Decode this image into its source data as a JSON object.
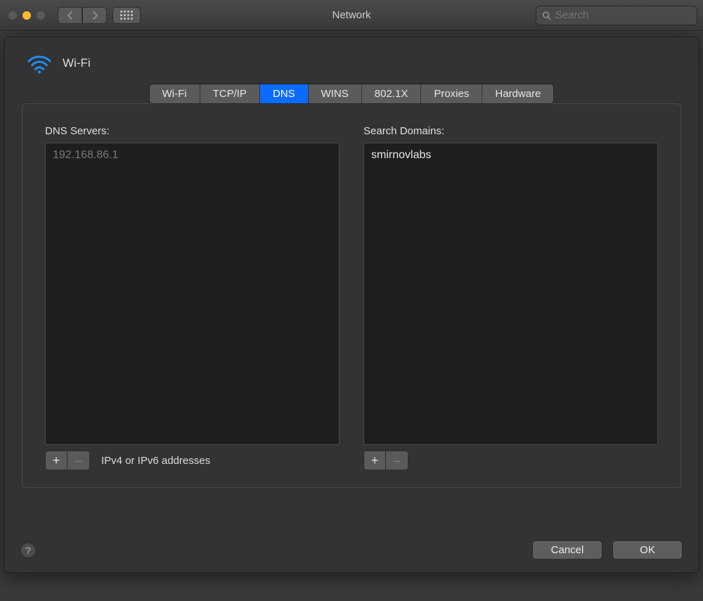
{
  "window": {
    "title": "Network"
  },
  "search": {
    "placeholder": "Search"
  },
  "header": {
    "interface_name": "Wi-Fi"
  },
  "tabs": {
    "items": [
      "Wi-Fi",
      "TCP/IP",
      "DNS",
      "WINS",
      "802.1X",
      "Proxies",
      "Hardware"
    ],
    "active_index": 2
  },
  "dns": {
    "servers_label": "DNS Servers:",
    "servers": [
      "192.168.86.1"
    ],
    "servers_hint": "IPv4 or IPv6 addresses",
    "domains_label": "Search Domains:",
    "domains": [
      "smirnovlabs"
    ]
  },
  "buttons": {
    "cancel": "Cancel",
    "ok": "OK"
  },
  "icons": {
    "plus": "+",
    "minus": "–"
  }
}
